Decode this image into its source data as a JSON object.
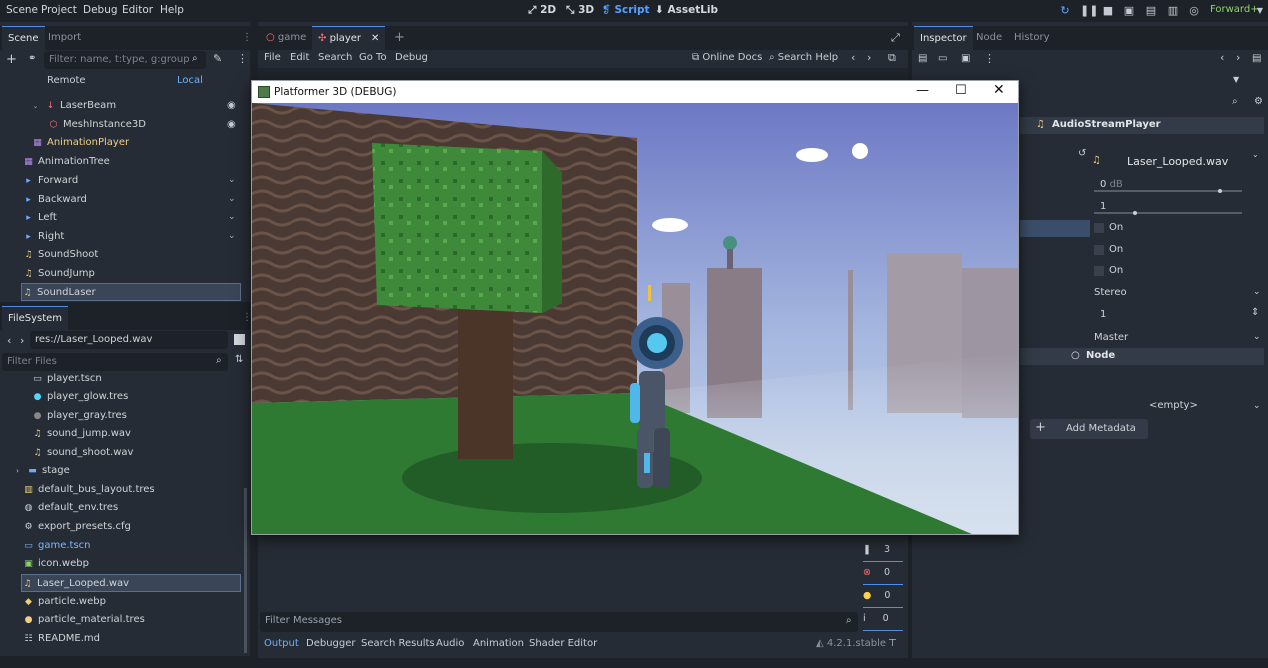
{
  "menubar": {
    "items": [
      "Scene",
      "Project",
      "Debug",
      "Editor",
      "Help"
    ]
  },
  "workspaces": {
    "w2d": "2D",
    "w3d": "3D",
    "script": "Script",
    "assetlib": "AssetLib"
  },
  "renderer": "Forward+",
  "scene_dock": {
    "tabs": [
      "Scene",
      "Import"
    ],
    "filter_placeholder": "Filter: name, t:type, g:group",
    "remote": "Remote",
    "local": "Local",
    "tree": [
      "LaserBeam",
      "MeshInstance3D",
      "AnimationPlayer",
      "AnimationTree",
      "Forward",
      "Backward",
      "Left",
      "Right",
      "SoundShoot",
      "SoundJump",
      "SoundLaser"
    ]
  },
  "filesystem": {
    "tab": "FileSystem",
    "path": "res://Laser_Looped.wav",
    "filter_placeholder": "Filter Files",
    "files": [
      "player.tscn",
      "player_glow.tres",
      "player_gray.tres",
      "sound_jump.wav",
      "sound_shoot.wav",
      "stage",
      "default_bus_layout.tres",
      "default_env.tres",
      "export_presets.cfg",
      "game.tscn",
      "icon.webp",
      "Laser_Looped.wav",
      "particle.webp",
      "particle_material.tres",
      "README.md"
    ]
  },
  "script_editor": {
    "tabs": [
      "game",
      "player"
    ],
    "menu": [
      "File",
      "Edit",
      "Search",
      "Go To",
      "Debug"
    ],
    "online_docs": "Online Docs",
    "search_help": "Search Help"
  },
  "game_window": {
    "title": "Platformer 3D (DEBUG)"
  },
  "output": {
    "filter_placeholder": "Filter Messages",
    "tabs": [
      "Output",
      "Debugger",
      "Search Results",
      "Audio",
      "Animation",
      "Shader Editor"
    ],
    "version": "4.2.1.stable",
    "counts": {
      "messages": "3",
      "errors": "0",
      "warnings": "0",
      "info": "0"
    }
  },
  "inspector": {
    "tabs": [
      "Inspector",
      "Node",
      "History"
    ],
    "node_type": "AudioStreamPlayer",
    "stream": "Laser_Looped.wav",
    "volume": "0",
    "volume_unit": "dB",
    "pitch": "1",
    "on1": "On",
    "on2": "On",
    "on3": "On",
    "mix_target": "Stereo",
    "max_polyphony": "1",
    "bus": "Master",
    "node_section": "Node",
    "metadata_empty": "<empty>",
    "add_metadata": "Add Metadata"
  }
}
